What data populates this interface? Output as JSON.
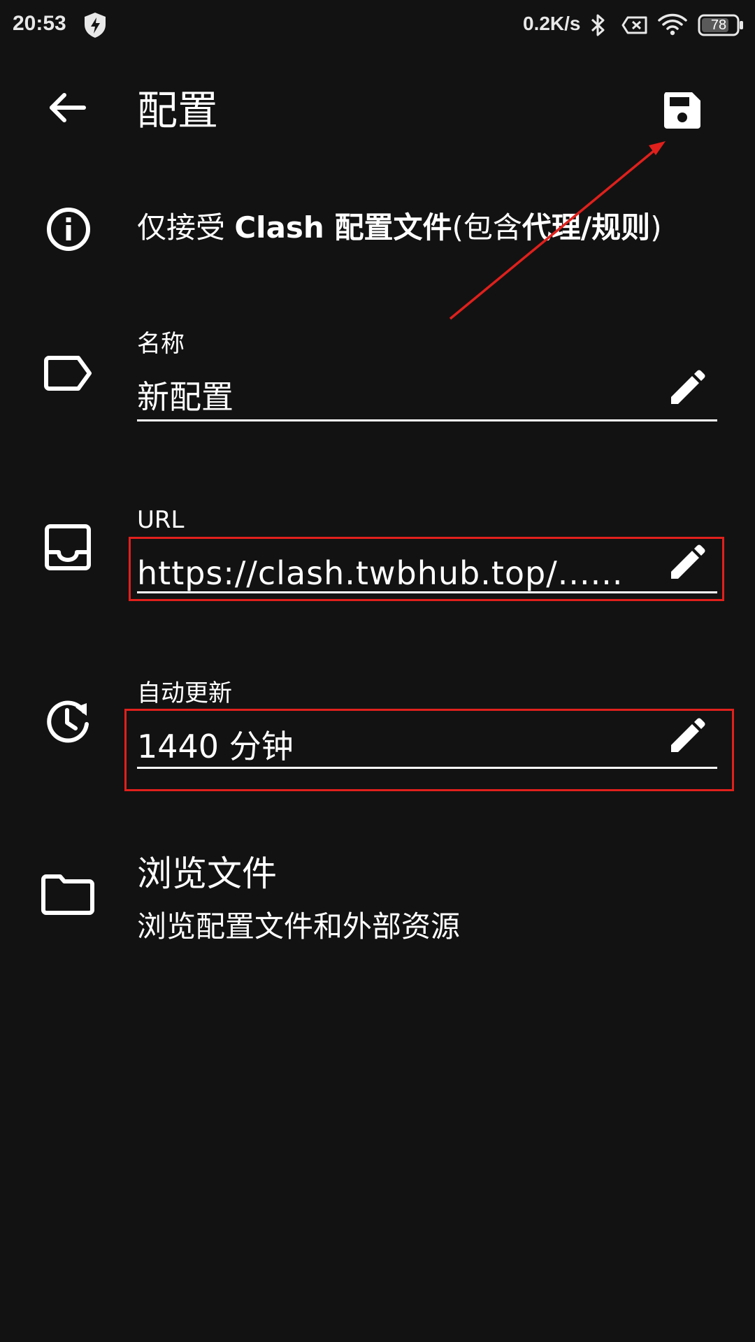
{
  "status_bar": {
    "time": "20:53",
    "net_speed": "0.2K/s",
    "battery": "78",
    "icons": [
      "vpn-shield-icon",
      "bluetooth-icon",
      "no-sim-icon",
      "wifi-icon",
      "battery-icon"
    ]
  },
  "toolbar": {
    "title": "配置",
    "back_icon": "arrow-left-icon",
    "save_icon": "floppy-disk-icon"
  },
  "info": {
    "prefix": "仅接受 ",
    "bold1": "Clash 配置文件",
    "middle": "(包含",
    "bold2": "代理/规则",
    "suffix": ")"
  },
  "fields": {
    "name": {
      "label": "名称",
      "value": "新配置"
    },
    "url": {
      "label": "URL",
      "value": "https://clash.twbhub.top/......"
    },
    "auto_update": {
      "label": "自动更新",
      "value": "1440 分钟"
    }
  },
  "browse": {
    "title": "浏览文件",
    "subtitle": "浏览配置文件和外部资源"
  },
  "colors": {
    "background": "#121212",
    "foreground": "#ffffff",
    "annotation": "#e0201c"
  }
}
